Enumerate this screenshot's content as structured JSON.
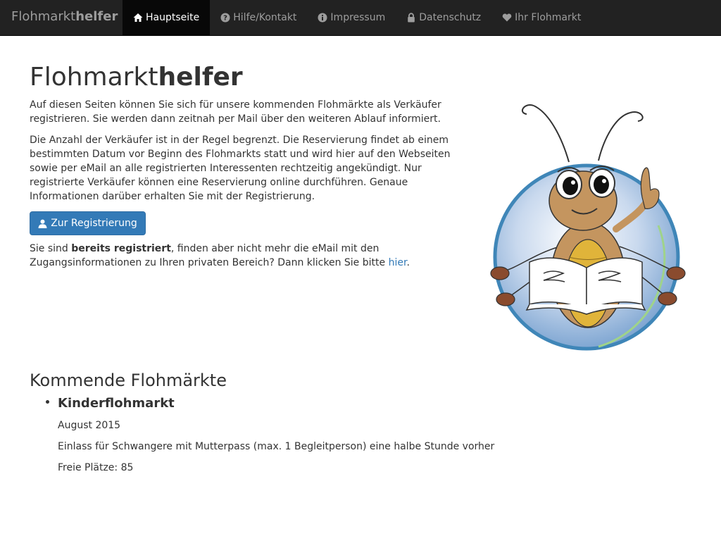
{
  "brand": {
    "part1": "Flohmarkt",
    "part2": "helfer"
  },
  "nav": [
    {
      "label": "Hauptseite",
      "icon": "home-icon",
      "active": true
    },
    {
      "label": "Hilfe/Kontakt",
      "icon": "question-circle-icon",
      "active": false
    },
    {
      "label": "Impressum",
      "icon": "info-circle-icon",
      "active": false
    },
    {
      "label": "Datenschutz",
      "icon": "lock-icon",
      "active": false
    },
    {
      "label": "Ihr Flohmarkt",
      "icon": "heart-icon",
      "active": false
    }
  ],
  "main": {
    "heading_part1": "Flohmarkt",
    "heading_part2": "helfer",
    "intro": "Auf diesen Seiten können Sie sich für unsere kommenden Flohmärkte als Verkäufer registrieren. Sie werden dann zeitnah per Mail über den weiteren Ablauf informiert.",
    "info": "Die Anzahl der Verkäufer ist in der Regel begrenzt. Die Reservierung findet ab einem bestimmten Datum vor Beginn des Flohmarkts statt und wird hier auf den Webseiten sowie per eMail an alle registrierten Interessenten rechtzeitig angekündigt. Nur registrierte Verkäufer können eine Reservierung online durchführen. Genaue Informationen darüber erhalten Sie mit der Registrierung.",
    "register_button": "Zur Registrierung",
    "already_prefix": "Sie sind ",
    "already_bold": "bereits registriert",
    "already_middle": ", finden aber nicht mehr die eMail mit den Zugangsinformationen zu Ihren privaten Bereich? Dann klicken Sie bitte ",
    "already_link": "hier",
    "already_suffix": "."
  },
  "upcoming": {
    "title": "Kommende Flohmärkte",
    "markets": [
      {
        "name": "Kinderflohmarkt",
        "date": "August 2015",
        "note": "Einlass für Schwangere mit Mutterpass (max. 1 Begleitperson) eine halbe Stunde vorher",
        "free_spots": "Freie Plätze: 85"
      }
    ]
  },
  "colors": {
    "navbar_bg": "#222222",
    "nav_active_bg": "#080808",
    "nav_text": "#9d9d9d",
    "primary": "#337ab7",
    "text": "#333333"
  }
}
